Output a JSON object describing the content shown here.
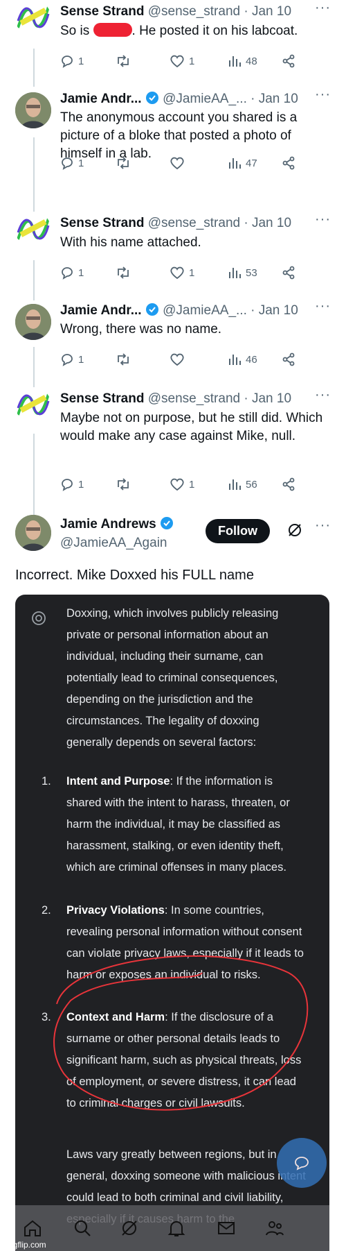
{
  "tweets": [
    {
      "name": "Sense Strand",
      "handle": "@sense_strand",
      "date": "· Jan 10",
      "text_before": "So is ",
      "text_after": ". He posted it on his labcoat.",
      "replies": "1",
      "likes": "1",
      "views": "48",
      "avatar": "sense-strand-logo"
    },
    {
      "name": "Jamie Andr...",
      "handle": "@JamieAA_...",
      "date": "· Jan 10",
      "text": "The anonymous account you shared is a picture of a bloke that posted a photo of himself in a lab.",
      "replies": "1",
      "likes": "",
      "views": "47",
      "avatar": "jamie-photo"
    },
    {
      "name": "Sense Strand",
      "handle": "@sense_strand",
      "date": "· Jan 10",
      "text": "With his name attached.",
      "replies": "1",
      "likes": "1",
      "views": "53",
      "avatar": "sense-strand-logo"
    },
    {
      "name": "Jamie Andr...",
      "handle": "@JamieAA_...",
      "date": "· Jan 10",
      "text": "Wrong, there was no name.",
      "replies": "1",
      "likes": "",
      "views": "46",
      "avatar": "jamie-photo"
    },
    {
      "name": "Sense Strand",
      "handle": "@sense_strand",
      "date": "· Jan 10",
      "text": "Maybe not on purpose, but he still did. Which would make any case against Mike, null.",
      "replies": "1",
      "likes": "1",
      "views": "56",
      "avatar": "sense-strand-logo"
    }
  ],
  "main_tweet": {
    "name": "Jamie Andrews",
    "handle": "@JamieAA_Again",
    "follow_label": "Follow",
    "text": "Incorrect. Mike Doxxed his FULL name"
  },
  "screenshot": {
    "intro": "Doxxing, which involves publicly releasing private or personal information about an individual, including their surname, can potentially lead to criminal consequences, depending on the jurisdiction and the circumstances. The legality of doxxing generally depends on several factors:",
    "items": [
      {
        "num": "1.",
        "title": "Intent and Purpose",
        "body": ": If the information is shared with the intent to harass, threaten, or harm the individual, it may be classified as harassment, stalking, or even identity theft, which are criminal offenses in many places."
      },
      {
        "num": "2.",
        "title": "Privacy Violations",
        "body": ": In some countries, revealing personal information without consent can violate privacy laws, especially if it leads to harm or exposes an individual to risks."
      },
      {
        "num": "3.",
        "title": "Context and Harm",
        "body": ": If the disclosure of a surname or other personal details leads to significant harm, such as physical threats, loss of employment, or severe distress, it can lead to criminal charges or civil lawsuits."
      }
    ],
    "outro": "Laws vary greatly between regions, but in general, doxxing someone with malicious intent could lead to both criminal and civil liability, especially if it causes harm to the"
  },
  "watermark": "imgflip.com",
  "colors": {
    "verified": "#1d9bf0",
    "text": "#0f1419",
    "muted": "#536471",
    "annotation": "#e8343a"
  }
}
